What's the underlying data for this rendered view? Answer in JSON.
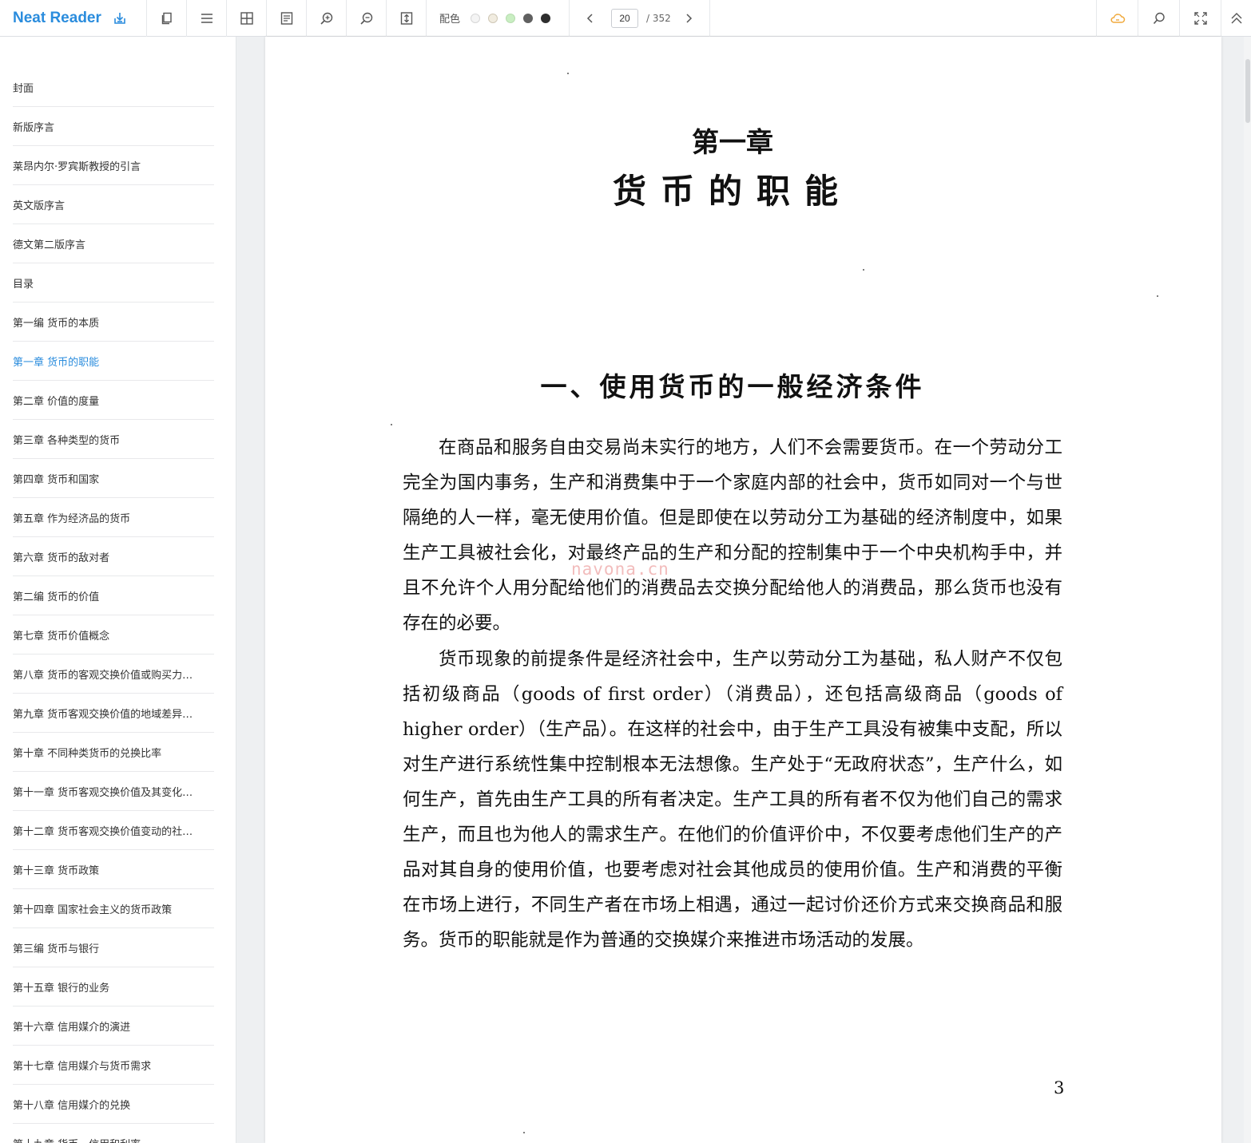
{
  "app": {
    "title": "Neat Reader"
  },
  "toolbar": {
    "theme_label": "配色",
    "swatch_colors": [
      "#f4f4f4",
      "#f1ece0",
      "#c9eec2",
      "#606060",
      "#2e2e2e"
    ],
    "page_current": "20",
    "page_total": "/ 352",
    "accent_color": "#2a8cdd",
    "cloud_color": "#f0a93b"
  },
  "sidebar": {
    "items": [
      {
        "label": "封面"
      },
      {
        "label": "新版序言"
      },
      {
        "label": "莱昂内尔·罗宾斯教授的引言"
      },
      {
        "label": "英文版序言"
      },
      {
        "label": "德文第二版序言"
      },
      {
        "label": "目录"
      },
      {
        "label": "第一编 货币的本质"
      },
      {
        "label": "第一章 货币的职能"
      },
      {
        "label": "第二章 价值的度量"
      },
      {
        "label": "第三章 各种类型的货币"
      },
      {
        "label": "第四章 货币和国家"
      },
      {
        "label": "第五章 作为经济品的货币"
      },
      {
        "label": "第六章 货币的敌对者"
      },
      {
        "label": "第二编 货币的价值"
      },
      {
        "label": "第七章 货币价值概念"
      },
      {
        "label": "第八章 货币的客观交换价值或购买力…"
      },
      {
        "label": "第九章 货币客观交换价值的地域差异…"
      },
      {
        "label": "第十章 不同种类货币的兑换比率"
      },
      {
        "label": "第十一章 货币客观交换价值及其变化…"
      },
      {
        "label": "第十二章 货币客观交换价值变动的社…"
      },
      {
        "label": "第十三章 货币政策"
      },
      {
        "label": "第十四章 国家社会主义的货币政策"
      },
      {
        "label": "第三编 货币与银行"
      },
      {
        "label": "第十五章 银行的业务"
      },
      {
        "label": "第十六章 信用媒介的演进"
      },
      {
        "label": "第十七章 信用媒介与货币需求"
      },
      {
        "label": "第十八章 信用媒介的兑换"
      },
      {
        "label": "第十九章 货币、信用和利率"
      }
    ],
    "active_index": 7
  },
  "page": {
    "chapter_number": "第一章",
    "chapter_title": "货币的职能",
    "section_title": "一、使用货币的一般经济条件",
    "paragraphs": [
      "在商品和服务自由交易尚未实行的地方，人们不会需要货币。在一个劳动分工完全为国内事务，生产和消费集中于一个家庭内部的社会中，货币如同对一个与世隔绝的人一样，毫无使用价值。但是即使在以劳动分工为基础的经济制度中，如果生产工具被社会化，对最终产品的生产和分配的控制集中于一个中央机构手中，并且不允许个人用分配给他们的消费品去交换分配给他人的消费品，那么货币也没有存在的必要。",
      "货币现象的前提条件是经济社会中，生产以劳动分工为基础，私人财产不仅包括初级商品（goods of first order）（消费品），还包括高级商品（goods of higher order）（生产品）。在这样的社会中，由于生产工具没有被集中支配，所以对生产进行系统性集中控制根本无法想像。生产处于“无政府状态”，生产什么，如何生产，首先由生产工具的所有者决定。生产工具的所有者不仅为他们自己的需求生产，而且也为他人的需求生产。在他们的价值评价中，不仅要考虑他们生产的产品对其自身的使用价值，也要考虑对社会其他成员的使用价值。生产和消费的平衡在市场上进行，不同生产者在市场上相遇，通过一起讨价还价方式来交换商品和服务。货币的职能就是作为普通的交换媒介来推进市场活动的发展。"
    ],
    "page_number": "3",
    "watermark": "navona.cn"
  }
}
